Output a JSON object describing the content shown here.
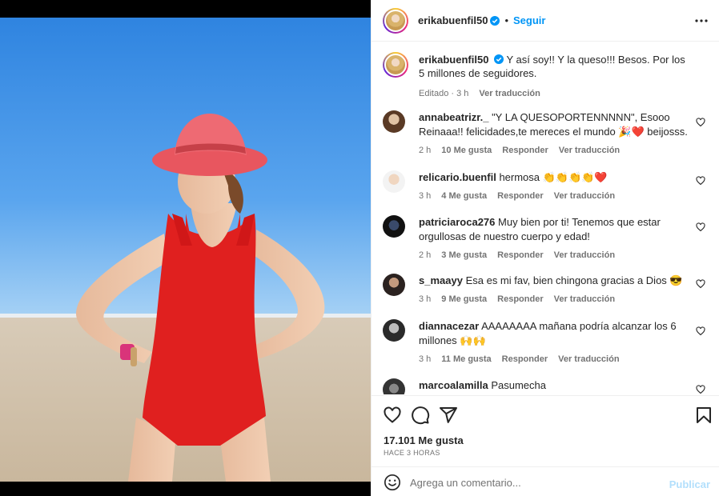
{
  "post": {
    "username": "erikabuenfil50",
    "dot": "•",
    "follow_label": "Seguir",
    "caption": "Y así soy!! Y la queso!!! Besos. Por los 5 millones de seguidores.",
    "caption_meta_time": "Editado · 3 h",
    "caption_meta_translate": "Ver traducción",
    "likes": "17.101 Me gusta",
    "time_ago": "HACE 3 HORAS"
  },
  "comments": [
    {
      "user": "annabeatrizr._",
      "text": "\"Y LA QUESOPORTENNNNN\", Esooo Reinaaa!! felicidades,te mereces el mundo 🎉❤️ beijosss.",
      "time": "2 h",
      "likes": "10 Me gusta",
      "reply": "Responder",
      "translate": "Ver traducción"
    },
    {
      "user": "relicario.buenfil",
      "text": "hermosa 👏👏👏👏❤️",
      "time": "3 h",
      "likes": "4 Me gusta",
      "reply": "Responder",
      "translate": "Ver traducción"
    },
    {
      "user": "patriciaroca276",
      "text": "Muy bien por ti! Tenemos que estar orgullosas de nuestro cuerpo y edad!",
      "time": "2 h",
      "likes": "3 Me gusta",
      "reply": "Responder",
      "translate": "Ver traducción"
    },
    {
      "user": "s_maayy",
      "text": "Esa es mi fav, bien chingona gracias a Dios 😎",
      "time": "3 h",
      "likes": "9 Me gusta",
      "reply": "Responder",
      "translate": "Ver traducción"
    },
    {
      "user": "diannacezar",
      "text": "AAAAAAAA mañana podría alcanzar los 6 millones 🙌🙌",
      "time": "3 h",
      "likes": "11 Me gusta",
      "reply": "Responder",
      "translate": "Ver traducción"
    },
    {
      "user": "marcoalamilla",
      "text": "Pasumecha",
      "time": "",
      "likes": "",
      "reply": "",
      "translate": ""
    }
  ],
  "composer": {
    "placeholder": "Agrega un comentario...",
    "publish_label": "Publicar"
  },
  "icons": {
    "verified": "verified-badge-icon",
    "more": "more-options-icon",
    "like": "heart-icon",
    "comment": "comment-icon",
    "share": "share-icon",
    "save": "bookmark-icon",
    "emoji": "emoji-icon"
  },
  "colors": {
    "accent": "#0095f6",
    "verified": "#0095f6",
    "muted": "#737373",
    "publish_disabled": "#b2dffc",
    "swimsuit": "#e0201f",
    "hat": "#e8565f"
  }
}
